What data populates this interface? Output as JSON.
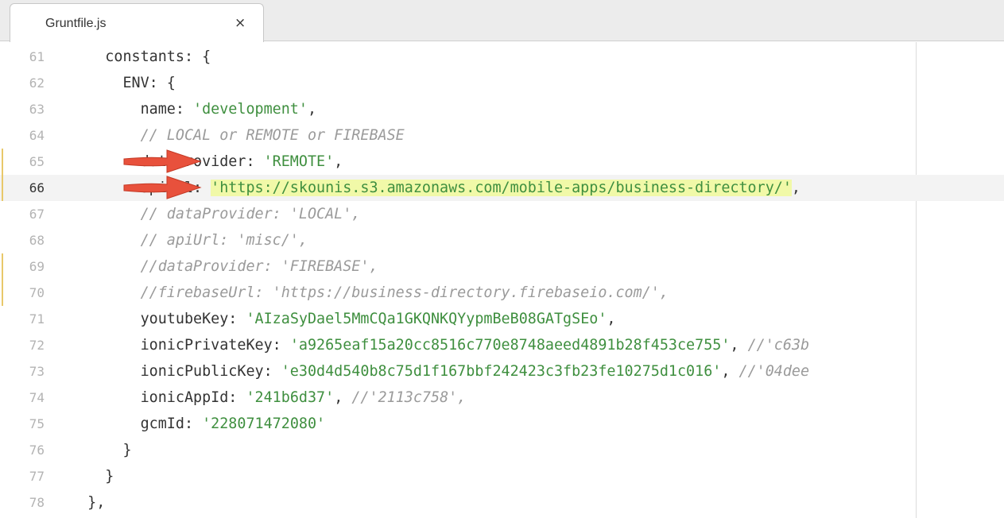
{
  "tab": {
    "title": "Gruntfile.js",
    "close_glyph": "×"
  },
  "lines": [
    {
      "num": "61",
      "indent": "    ",
      "parts": [
        {
          "t": "k",
          "v": "constants: {"
        }
      ]
    },
    {
      "num": "62",
      "indent": "      ",
      "parts": [
        {
          "t": "k",
          "v": "ENV: {"
        }
      ]
    },
    {
      "num": "63",
      "indent": "        ",
      "parts": [
        {
          "t": "k",
          "v": "name: "
        },
        {
          "t": "s",
          "v": "'development'"
        },
        {
          "t": "k",
          "v": ","
        }
      ]
    },
    {
      "num": "64",
      "indent": "        ",
      "parts": [
        {
          "t": "c",
          "v": "// LOCAL or REMOTE or FIREBASE"
        }
      ]
    },
    {
      "num": "65",
      "indent": "        ",
      "parts": [
        {
          "t": "k",
          "v": "dataProvider: "
        },
        {
          "t": "s",
          "v": "'REMOTE'"
        },
        {
          "t": "k",
          "v": ","
        }
      ]
    },
    {
      "num": "66",
      "indent": "        ",
      "parts": [
        {
          "t": "k",
          "v": "apiUrl: "
        },
        {
          "t": "s",
          "v": "'https://skounis.s3.amazonaws.com/mobile-apps/business-directory/'"
        },
        {
          "t": "k",
          "v": ","
        }
      ]
    },
    {
      "num": "67",
      "indent": "        ",
      "parts": [
        {
          "t": "c",
          "v": "// dataProvider: 'LOCAL',"
        }
      ]
    },
    {
      "num": "68",
      "indent": "        ",
      "parts": [
        {
          "t": "c",
          "v": "// apiUrl: 'misc/',"
        }
      ]
    },
    {
      "num": "69",
      "indent": "        ",
      "parts": [
        {
          "t": "c",
          "v": "//dataProvider: 'FIREBASE',"
        }
      ]
    },
    {
      "num": "70",
      "indent": "        ",
      "parts": [
        {
          "t": "c",
          "v": "//firebaseUrl: 'https://business-directory.firebaseio.com/',"
        }
      ]
    },
    {
      "num": "71",
      "indent": "        ",
      "parts": [
        {
          "t": "k",
          "v": "youtubeKey: "
        },
        {
          "t": "s",
          "v": "'AIzaSyDael5MmCQa1GKQNKQYypmBeB08GATgSEo'"
        },
        {
          "t": "k",
          "v": ","
        }
      ]
    },
    {
      "num": "72",
      "indent": "        ",
      "parts": [
        {
          "t": "k",
          "v": "ionicPrivateKey: "
        },
        {
          "t": "s",
          "v": "'a9265eaf15a20cc8516c770e8748aeed4891b28f453ce755'"
        },
        {
          "t": "k",
          "v": ", "
        },
        {
          "t": "c",
          "v": "//'c63b"
        }
      ]
    },
    {
      "num": "73",
      "indent": "        ",
      "parts": [
        {
          "t": "k",
          "v": "ionicPublicKey: "
        },
        {
          "t": "s",
          "v": "'e30d4d540b8c75d1f167bbf242423c3fb23fe10275d1c016'"
        },
        {
          "t": "k",
          "v": ", "
        },
        {
          "t": "c",
          "v": "//'04dee"
        }
      ]
    },
    {
      "num": "74",
      "indent": "        ",
      "parts": [
        {
          "t": "k",
          "v": "ionicAppId: "
        },
        {
          "t": "s",
          "v": "'241b6d37'"
        },
        {
          "t": "k",
          "v": ", "
        },
        {
          "t": "c",
          "v": "//'2113c758',"
        }
      ]
    },
    {
      "num": "75",
      "indent": "        ",
      "parts": [
        {
          "t": "k",
          "v": "gcmId: "
        },
        {
          "t": "s",
          "v": "'228071472080'"
        }
      ]
    },
    {
      "num": "76",
      "indent": "      ",
      "parts": [
        {
          "t": "k",
          "v": "}"
        }
      ]
    },
    {
      "num": "77",
      "indent": "    ",
      "parts": [
        {
          "t": "k",
          "v": "}"
        }
      ]
    },
    {
      "num": "78",
      "indent": "  ",
      "parts": [
        {
          "t": "k",
          "v": "},"
        }
      ]
    }
  ],
  "current_line": "66",
  "modified_lines": [
    "65",
    "66",
    "69",
    "70"
  ],
  "highlighted_line": "66",
  "arrow_lines": [
    "65",
    "66"
  ],
  "colors": {
    "string": "#3f8f3f",
    "comment": "#9a9a9a",
    "highlight": "#f1f9a8",
    "arrow": "#e8513c"
  }
}
